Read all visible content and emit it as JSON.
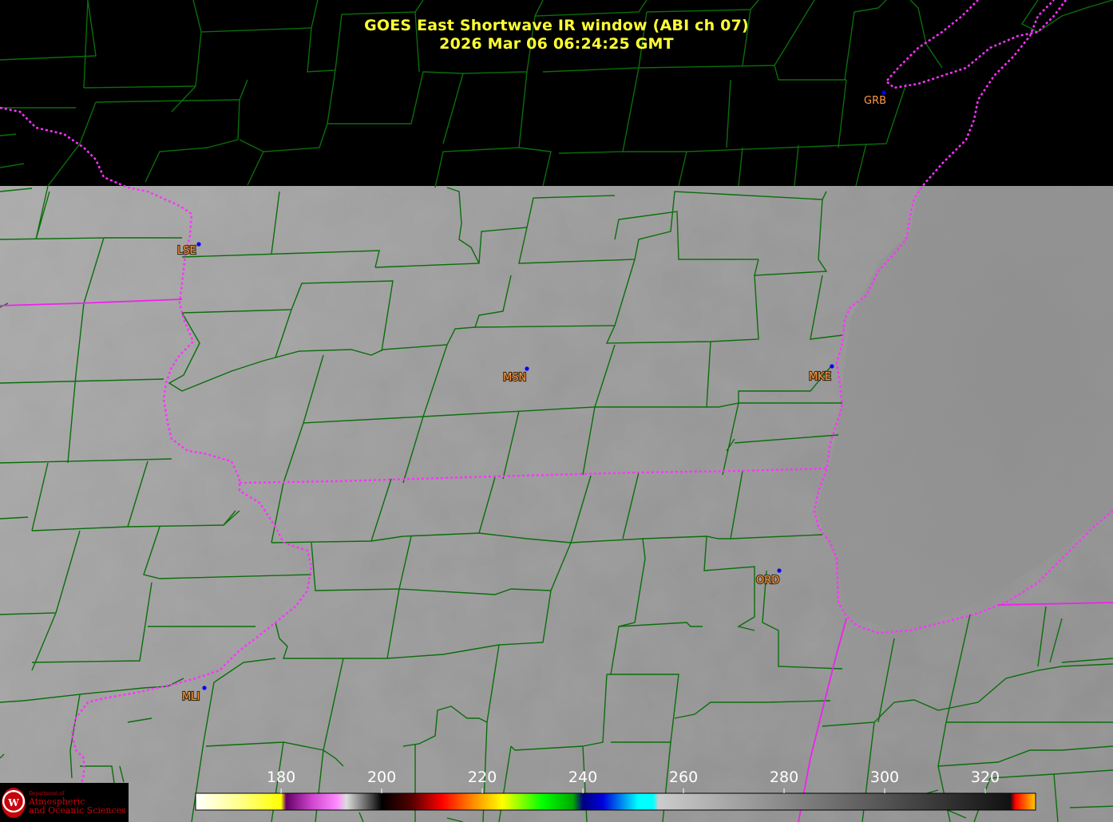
{
  "title": {
    "line1": "GOES East Shortwave IR window (ABI ch 07)",
    "line2": "2026 Mar 06  06:24:25 GMT",
    "color": "#ffff33"
  },
  "colors": {
    "background": "#000000",
    "county_lines": "#0a6e0a",
    "state_lines": "#ff33ff",
    "station_label": "#ff9944",
    "station_dot": "#0000ff",
    "tick_label": "#ffffff"
  },
  "stations": [
    {
      "id": "GRB",
      "label": "GRB",
      "over_image": false
    },
    {
      "id": "LSE",
      "label": "LSE",
      "over_image": true
    },
    {
      "id": "MSN",
      "label": "MSN",
      "over_image": true
    },
    {
      "id": "MKE",
      "label": "MKE",
      "over_image": true
    },
    {
      "id": "ORD",
      "label": "ORD",
      "over_image": true
    },
    {
      "id": "MLI",
      "label": "MLI",
      "over_image": true
    }
  ],
  "colorbar": {
    "min": 163,
    "max": 330,
    "ticks": [
      "180",
      "200",
      "220",
      "240",
      "260",
      "280",
      "300",
      "320"
    ],
    "tick_values": [
      180,
      200,
      220,
      240,
      260,
      280,
      300,
      320
    ],
    "stops": [
      [
        163,
        "#ffffff"
      ],
      [
        172,
        "#ffff88"
      ],
      [
        180,
        "#ffff00"
      ],
      [
        181,
        "#660066"
      ],
      [
        186,
        "#cc44cc"
      ],
      [
        191,
        "#ff88ff"
      ],
      [
        193,
        "#dddddd"
      ],
      [
        198,
        "#444444"
      ],
      [
        200,
        "#000000"
      ],
      [
        206,
        "#550000"
      ],
      [
        212,
        "#ff0000"
      ],
      [
        218,
        "#ff8800"
      ],
      [
        224,
        "#ffff00"
      ],
      [
        232,
        "#00ff00"
      ],
      [
        238,
        "#00aa00"
      ],
      [
        240,
        "#000080"
      ],
      [
        244,
        "#0000dd"
      ],
      [
        251,
        "#00ffff"
      ],
      [
        254,
        "#00ffff"
      ],
      [
        255,
        "#cccccc"
      ],
      [
        325,
        "#111111"
      ],
      [
        326,
        "#ff0000"
      ],
      [
        328,
        "#ff6600"
      ],
      [
        330,
        "#ffcc00"
      ]
    ]
  },
  "logo": {
    "dept": "Department of",
    "name1": "Atmospheric",
    "name2": "and Oceanic Sciences",
    "seal": "W"
  }
}
